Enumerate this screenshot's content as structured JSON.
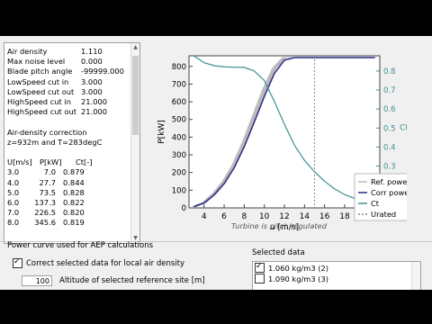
{
  "info": {
    "params": [
      {
        "label": "Air density",
        "value": "1.110"
      },
      {
        "label": "Max noise level",
        "value": "0.000"
      },
      {
        "label": "Blade pitch angle",
        "value": "-99999.000"
      },
      {
        "label": "LowSpeed cut in",
        "value": "3.000"
      },
      {
        "label": "LowSpeed cut out",
        "value": "3.000"
      },
      {
        "label": "HighSpeed cut in",
        "value": "21.000"
      },
      {
        "label": "HighSpeed cut out",
        "value": "21.000"
      }
    ],
    "correction_title": "Air-density correction",
    "correction_detail": "z=932m and T=283degC",
    "table_headers": [
      "U[m/s]",
      "P[kW]",
      "Ct[-]"
    ],
    "table_rows": [
      [
        "3.0",
        "7.0",
        "0.879"
      ],
      [
        "4.0",
        "27.7",
        "0.844"
      ],
      [
        "5.0",
        "73.5",
        "0.828"
      ],
      [
        "6.0",
        "137.3",
        "0.822"
      ],
      [
        "7.0",
        "226.5",
        "0.820"
      ],
      [
        "8.0",
        "345.6",
        "0.819"
      ]
    ]
  },
  "chart_data": {
    "type": "line",
    "x": [
      3,
      4,
      5,
      6,
      7,
      8,
      9,
      10,
      11,
      12,
      13,
      14,
      15,
      16,
      17,
      18,
      19,
      20,
      21
    ],
    "series": [
      {
        "name": "Ref. power",
        "axis": "left",
        "color": "#b8b8b8",
        "values": [
          7,
          30,
          79,
          148,
          244,
          372,
          520,
          668,
          790,
          850,
          850,
          850,
          850,
          850,
          850,
          850,
          850,
          850,
          850
        ]
      },
      {
        "name": "Corr power",
        "axis": "left",
        "color": "#2b2b8c",
        "values": [
          7.0,
          27.7,
          73.5,
          137.3,
          226.5,
          345.6,
          485,
          630,
          760,
          835,
          850,
          850,
          850,
          850,
          850,
          850,
          850,
          850,
          850
        ]
      },
      {
        "name": "Ct",
        "axis": "right",
        "color": "#3f8f8f",
        "values": [
          0.879,
          0.844,
          0.828,
          0.822,
          0.82,
          0.819,
          0.8,
          0.75,
          0.64,
          0.52,
          0.41,
          0.33,
          0.27,
          0.22,
          0.18,
          0.15,
          0.13,
          0.11,
          0.09
        ]
      },
      {
        "name": "Urated",
        "axis": "left",
        "color": "#888888",
        "style": "dotted",
        "vertical_at": 15
      }
    ],
    "xlabel": "u [m/s]",
    "ylabel": "P[kW]",
    "y2label": "Ct",
    "xlim": [
      2.5,
      21.5
    ],
    "xticks": [
      4,
      6,
      8,
      10,
      12,
      14,
      16,
      18,
      20
    ],
    "ylim": [
      0,
      860
    ],
    "yticks": [
      0,
      100,
      200,
      300,
      400,
      500,
      600,
      700,
      800
    ],
    "y2lim": [
      0.08,
      0.88
    ],
    "y2ticks": [
      0.1,
      0.2,
      0.3,
      0.4,
      0.5,
      0.6,
      0.7,
      0.8
    ],
    "legend_position": "right-middle",
    "grid": false,
    "caption": "Turbine is pitch regulated"
  },
  "bottom": {
    "power_curve_label": "Power curve used for AEP calculations",
    "correct_checkbox_label": "Correct selected data for local air density",
    "altitude_value": "100",
    "altitude_label": "Altitude of selected reference site [m]",
    "selected_label": "Selected data",
    "selected_items": [
      {
        "label": "1.060 kg/m3 (2)",
        "checked": true
      },
      {
        "label": "1.090 kg/m3 (3)",
        "checked": false
      }
    ]
  }
}
